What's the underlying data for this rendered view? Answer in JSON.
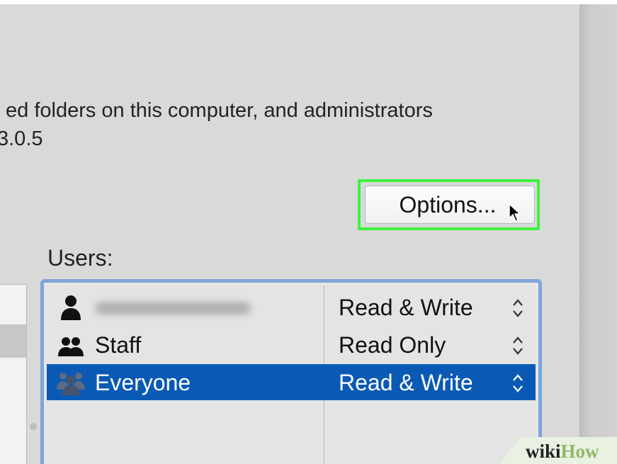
{
  "description": {
    "line1": "ed folders on this computer, and administrators",
    "line2": "3.0.5"
  },
  "options_button": {
    "label": "Options..."
  },
  "users": {
    "label": "Users:",
    "rows": [
      {
        "name": "",
        "permission": "Read & Write",
        "icon": "single-user-icon",
        "selected": false,
        "name_obscured": true
      },
      {
        "name": "Staff",
        "permission": "Read Only",
        "icon": "group-icon",
        "selected": false
      },
      {
        "name": "Everyone",
        "permission": "Read & Write",
        "icon": "everyone-icon",
        "selected": true
      }
    ]
  },
  "watermark": {
    "part1": "wiki",
    "part2": "How"
  },
  "colors": {
    "highlight_outline": "#3ef23e",
    "selection": "#0a5ab5",
    "focus_ring": "#7ea6d8",
    "watermark_how": "#93b766"
  }
}
